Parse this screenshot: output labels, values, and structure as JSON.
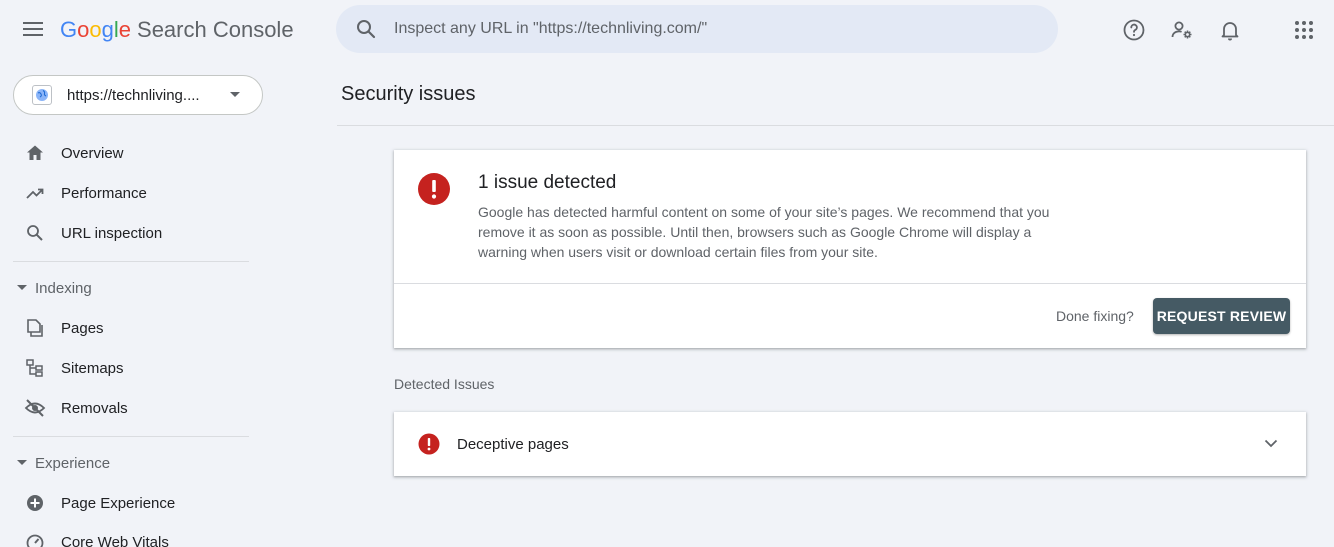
{
  "header": {
    "logo_letters": [
      "G",
      "o",
      "o",
      "g",
      "l",
      "e"
    ],
    "product_name": "Search Console",
    "search_placeholder": "Inspect any URL in \"https://technliving.com/\""
  },
  "sidebar": {
    "property_label": "https://technliving....",
    "items_top": [
      {
        "label": "Overview",
        "icon": "home-icon"
      },
      {
        "label": "Performance",
        "icon": "trending-up-icon"
      },
      {
        "label": "URL inspection",
        "icon": "search-icon"
      }
    ],
    "sections": [
      {
        "title": "Indexing",
        "items": [
          {
            "label": "Pages",
            "icon": "pages-icon"
          },
          {
            "label": "Sitemaps",
            "icon": "sitemap-icon"
          },
          {
            "label": "Removals",
            "icon": "visibility-off-icon"
          }
        ]
      },
      {
        "title": "Experience",
        "items": [
          {
            "label": "Page Experience",
            "icon": "plus-circle-icon"
          },
          {
            "label": "Core Web Vitals",
            "icon": "speed-icon"
          }
        ]
      }
    ]
  },
  "main": {
    "page_title": "Security issues",
    "summary": {
      "title": "1 issue detected",
      "description": "Google has detected harmful content on some of your site’s pages. We recommend that you remove it as soon as possible. Until then, browsers such as Google Chrome will display a warning when users visit or download certain files from your site.",
      "done_prompt": "Done fixing?",
      "button_label": "REQUEST REVIEW"
    },
    "detected_label": "Detected Issues",
    "issues": [
      {
        "label": "Deceptive pages"
      }
    ]
  },
  "colors": {
    "background": "#f1f3f8",
    "error_red": "#c5221f",
    "button_bg": "#455a64",
    "search_bg": "#e3e9f5"
  }
}
